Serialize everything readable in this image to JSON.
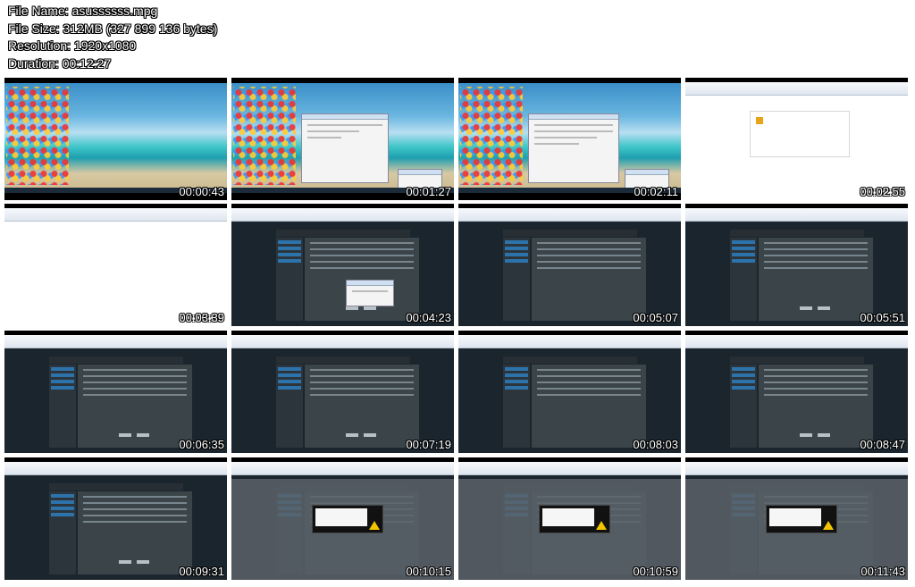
{
  "meta": {
    "file_name": "File Name: asussssss.mpg",
    "file_size": "File Size: 312MB (327 899 136 bytes)",
    "resolution": "Resolution: 1920x1080",
    "duration": "Duration: 00:12:27"
  },
  "thumbnails": [
    {
      "time": "00:00:43",
      "scene": "desktop"
    },
    {
      "time": "00:01:27",
      "scene": "desktop-dialog"
    },
    {
      "time": "00:02:11",
      "scene": "desktop-dialog-list"
    },
    {
      "time": "00:02:55",
      "scene": "browser-warning"
    },
    {
      "time": "00:03:39",
      "scene": "browser-blank"
    },
    {
      "time": "00:04:23",
      "scene": "router-popup"
    },
    {
      "time": "00:05:07",
      "scene": "router"
    },
    {
      "time": "00:05:51",
      "scene": "router-form"
    },
    {
      "time": "00:06:35",
      "scene": "router-form"
    },
    {
      "time": "00:07:19",
      "scene": "router-form"
    },
    {
      "time": "00:08:03",
      "scene": "router"
    },
    {
      "time": "00:08:47",
      "scene": "router-form"
    },
    {
      "time": "00:09:31",
      "scene": "router-form"
    },
    {
      "time": "00:10:15",
      "scene": "router-alert"
    },
    {
      "time": "00:10:59",
      "scene": "router-alert"
    },
    {
      "time": "00:11:43",
      "scene": "router-alert"
    }
  ],
  "colors": {
    "router_bg": "#1b252d",
    "router_accent": "#2d73ab",
    "alert_warning": "#f2c400"
  }
}
